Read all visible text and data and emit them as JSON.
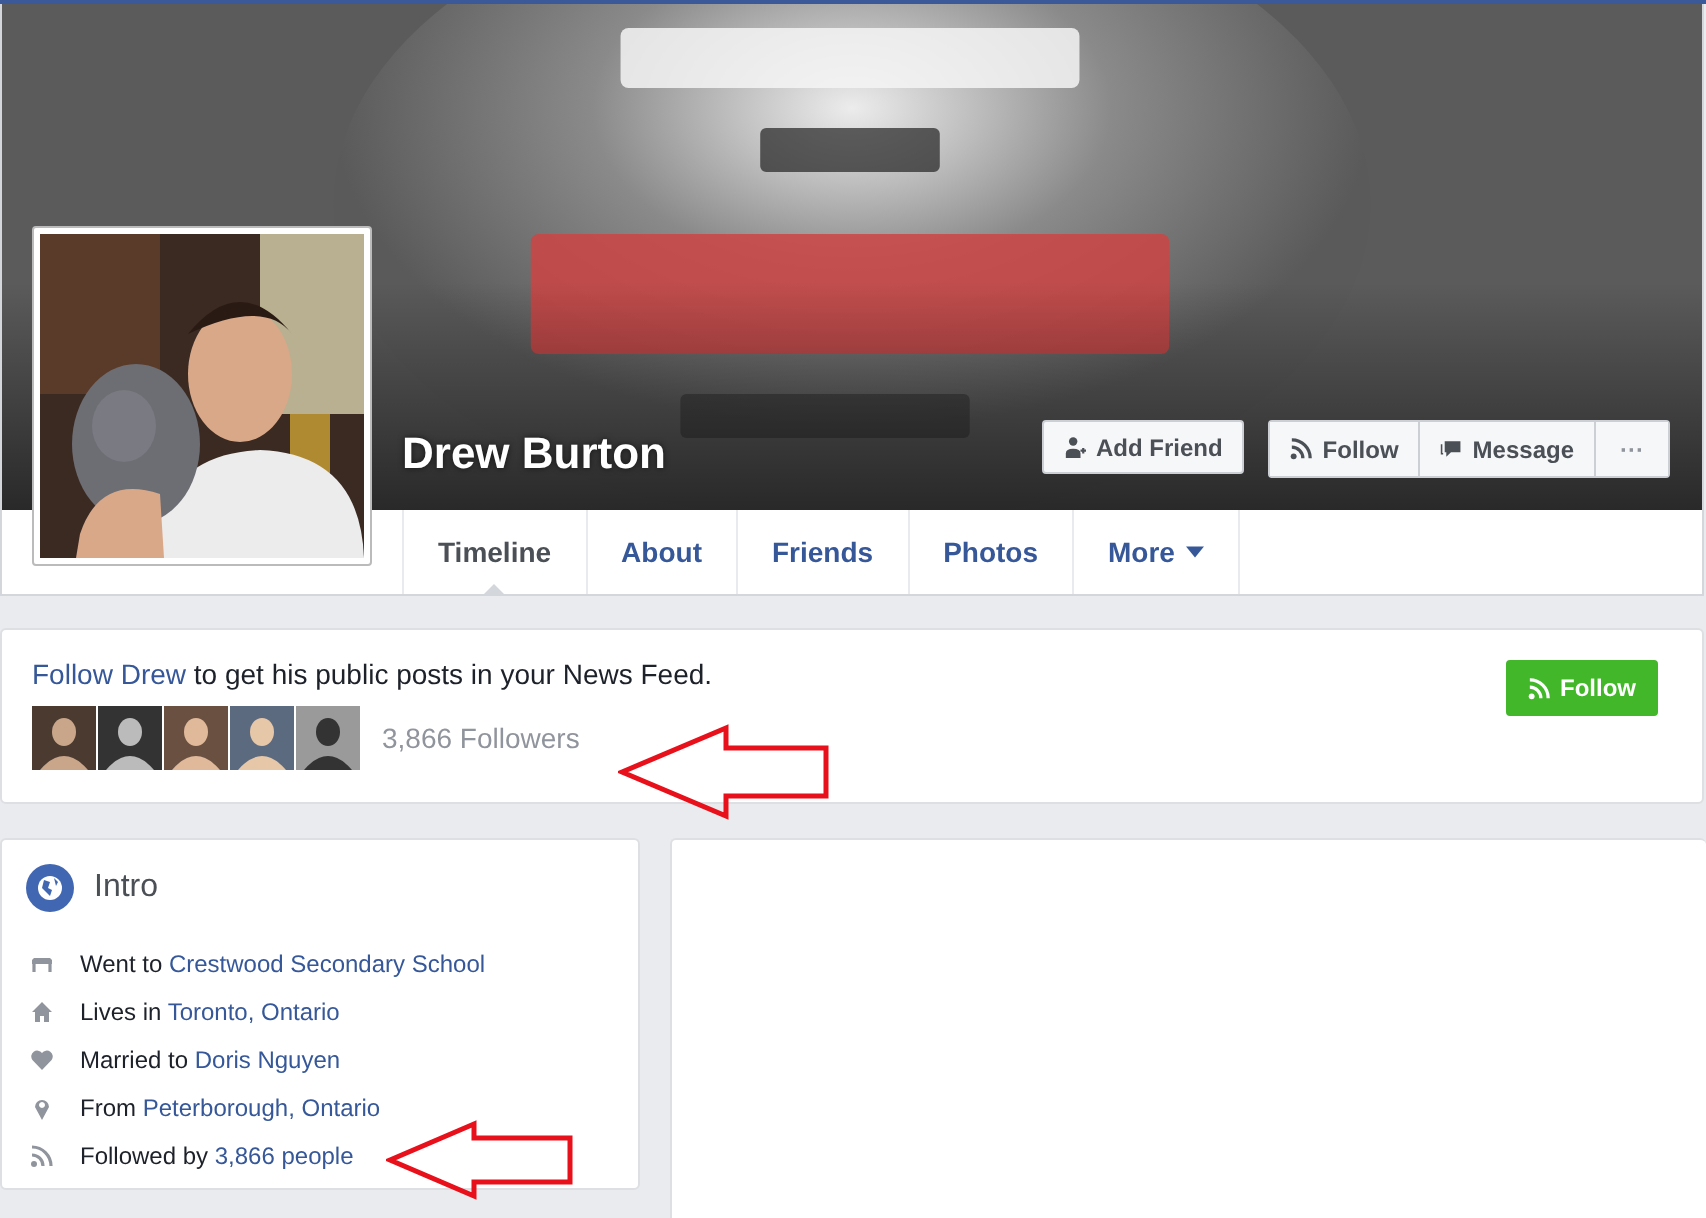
{
  "profile": {
    "name": "Drew Burton"
  },
  "actions": [
    {
      "label": "Add Friend",
      "kind": "add-friend"
    },
    {
      "label": "Follow",
      "kind": "follow"
    },
    {
      "label": "Message",
      "kind": "message"
    },
    {
      "label": "···",
      "kind": "more"
    }
  ],
  "tabs": [
    {
      "label": "Timeline",
      "selected": true
    },
    {
      "label": "About",
      "selected": false
    },
    {
      "label": "Friends",
      "selected": false
    },
    {
      "label": "Photos",
      "selected": false
    },
    {
      "label": "More",
      "selected": false,
      "dropdown": true
    }
  ],
  "follow_card": {
    "link": "Follow Drew",
    "text": " to get his public posts in your News Feed.",
    "followers": "3,866 Followers",
    "button": "Follow"
  },
  "intro": {
    "title": "Intro",
    "items": [
      {
        "kind": "school",
        "text": "Went to ",
        "link": "Crestwood Secondary School"
      },
      {
        "kind": "home",
        "text": "Lives in ",
        "link": "Toronto, Ontario"
      },
      {
        "kind": "heart",
        "text": "Married to ",
        "link": "Doris Nguyen"
      },
      {
        "kind": "pin",
        "text": "From ",
        "link": "Peterborough, Ontario"
      },
      {
        "kind": "feed",
        "text": "Followed by ",
        "link": "3,866 people"
      }
    ]
  }
}
